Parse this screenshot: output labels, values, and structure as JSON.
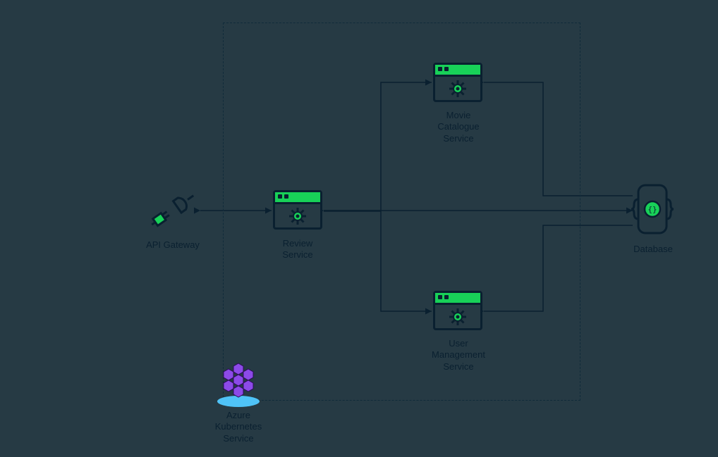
{
  "nodes": {
    "api_gateway": {
      "label": "API Gateway"
    },
    "review": {
      "label": "Review\nService"
    },
    "movie": {
      "label": "Movie\nCatalogue\nService"
    },
    "user": {
      "label": "User\nManagement\nService"
    },
    "database": {
      "label": "Database"
    },
    "aks": {
      "label": "Azure\nKubernetes\nService"
    }
  },
  "colors": {
    "accent_green": "#18d158",
    "dark": "#0a2030",
    "bg": "#263a44",
    "aks_purple": "#8c4ae8",
    "aks_platform": "#4fc3f7"
  }
}
